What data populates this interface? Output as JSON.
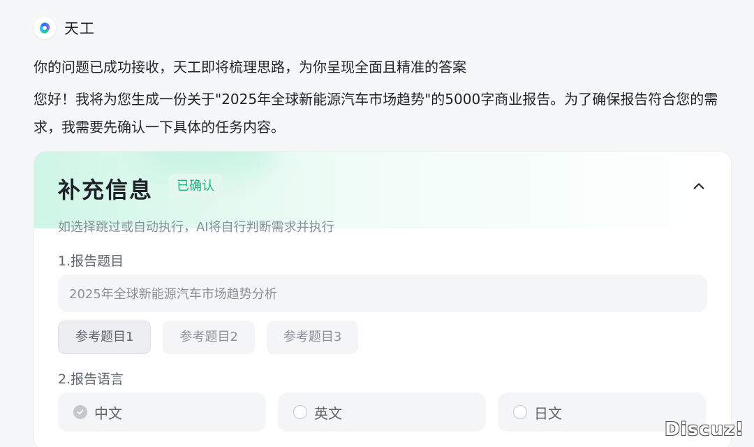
{
  "app": {
    "name": "天工"
  },
  "messages": {
    "status": "你的问题已成功接收，天工即将梳理思路，为你呈现全面且精准的答案",
    "reply": "您好！我将为您生成一份关于\"2025年全球新能源汽车市场趋势\"的5000字商业报告。为了确保报告符合您的需求，我需要先确认一下具体的任务内容。"
  },
  "card": {
    "title": "补充信息",
    "badge": "已确认",
    "hint": "如选择跳过或自动执行，AI将自行判断需求并执行",
    "field1": {
      "label": "1.报告题目",
      "value": "2025年全球新能源汽车市场趋势分析",
      "chips": [
        "参考题目1",
        "参考题目2",
        "参考题目3"
      ],
      "selected_chip": "参考题目1"
    },
    "field2": {
      "label": "2.报告语言",
      "options": [
        "中文",
        "英文",
        "日文"
      ],
      "selected": "中文"
    }
  },
  "watermark": "Discuz!",
  "colors": {
    "accent_green": "#1fb27d",
    "badge_bg": "#e3f7ef",
    "page_bg": "#f6f7f8"
  }
}
